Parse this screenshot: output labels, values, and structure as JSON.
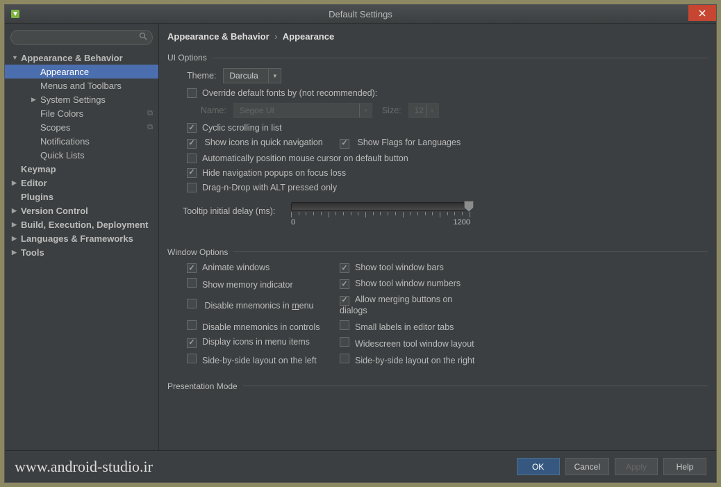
{
  "window": {
    "title": "Default Settings"
  },
  "breadcrumb": {
    "a": "Appearance & Behavior",
    "b": "Appearance"
  },
  "sidebar": {
    "items": [
      {
        "label": "Appearance & Behavior",
        "depth": 0,
        "arrow": "down",
        "bold": true
      },
      {
        "label": "Appearance",
        "depth": 1,
        "selected": true
      },
      {
        "label": "Menus and Toolbars",
        "depth": 1
      },
      {
        "label": "System Settings",
        "depth": 1,
        "arrow": "right"
      },
      {
        "label": "File Colors",
        "depth": 1,
        "badge": "⧉"
      },
      {
        "label": "Scopes",
        "depth": 1,
        "badge": "⧉"
      },
      {
        "label": "Notifications",
        "depth": 1
      },
      {
        "label": "Quick Lists",
        "depth": 1
      },
      {
        "label": "Keymap",
        "depth": 0,
        "bold": true
      },
      {
        "label": "Editor",
        "depth": 0,
        "arrow": "right",
        "bold": true
      },
      {
        "label": "Plugins",
        "depth": 0,
        "bold": true
      },
      {
        "label": "Version Control",
        "depth": 0,
        "arrow": "right",
        "bold": true
      },
      {
        "label": "Build, Execution, Deployment",
        "depth": 0,
        "arrow": "right",
        "bold": true
      },
      {
        "label": "Languages & Frameworks",
        "depth": 0,
        "arrow": "right",
        "bold": true
      },
      {
        "label": "Tools",
        "depth": 0,
        "arrow": "right",
        "bold": true
      }
    ]
  },
  "ui_options": {
    "title": "UI Options",
    "theme_label": "Theme:",
    "theme_value": "Darcula",
    "override_fonts": "Override default fonts by (not recommended):",
    "name_label": "Name:",
    "name_value": "Segoe UI",
    "size_label": "Size:",
    "size_value": "12",
    "cyclic": "Cyclic scrolling in list",
    "show_icons": "Show icons in quick navigation",
    "show_flags": "Show Flags for Languages",
    "auto_mouse": "Automatically position mouse cursor on default button",
    "hide_popup": "Hide navigation popups on focus loss",
    "drag_alt": "Drag-n-Drop with ALT pressed only",
    "tooltip_label": "Tooltip initial delay (ms):",
    "tooltip_min": "0",
    "tooltip_max": "1200"
  },
  "window_options": {
    "title": "Window Options",
    "animate": "Animate windows",
    "memory": "Show memory indicator",
    "disable_menu": "Disable mnemonics in menu",
    "disable_menu_pre": "Disable mnemonics in ",
    "disable_menu_u": "m",
    "disable_menu_post": "enu",
    "disable_ctrl": "Disable mnemonics in controls",
    "display_icons": "Display icons in menu items",
    "side_left": "Side-by-side layout on the left",
    "show_bars": "Show tool window bars",
    "show_numbers": "Show tool window numbers",
    "allow_merge": "Allow merging buttons on dialogs",
    "small_labels": "Small labels in editor tabs",
    "widescreen": "Widescreen tool window layout",
    "side_right": "Side-by-side layout on the right"
  },
  "presentation": {
    "title": "Presentation Mode"
  },
  "footer": {
    "watermark": "www.android-studio.ir",
    "ok": "OK",
    "cancel": "Cancel",
    "apply": "Apply",
    "help": "Help"
  }
}
